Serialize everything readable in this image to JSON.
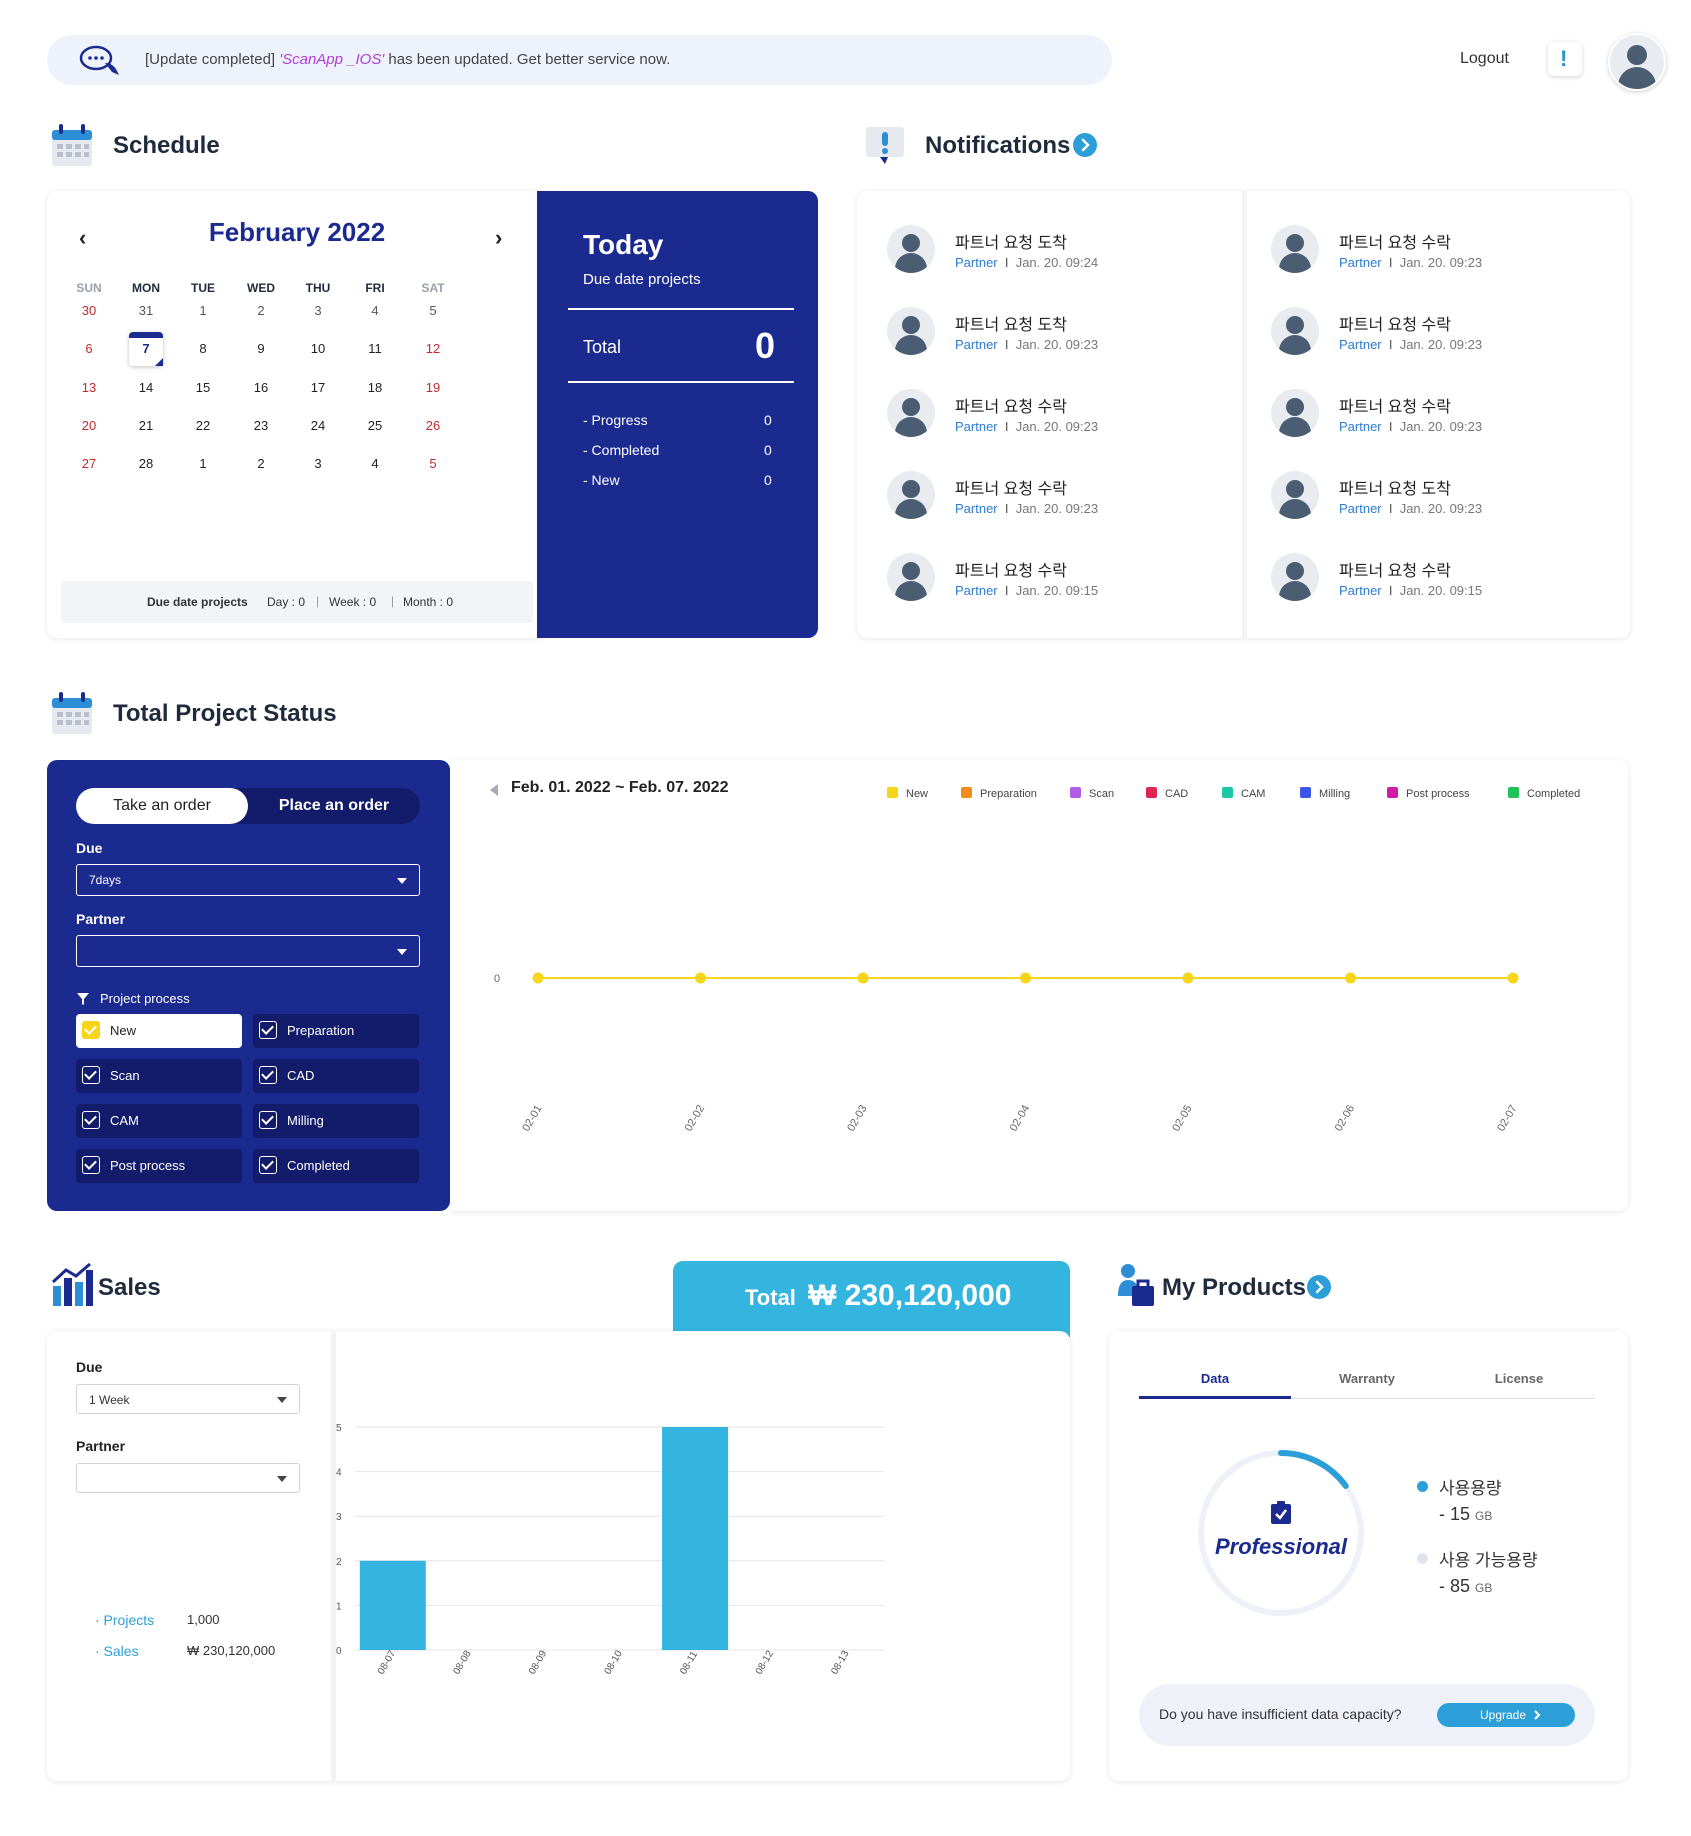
{
  "banner": {
    "prefix": "[Update completed]",
    "app": "'ScanApp _IOS'",
    "suffix": "has been updated. Get better service now."
  },
  "header": {
    "logout_label": "Logout",
    "alert_glyph": "!"
  },
  "schedule": {
    "title": "Schedule",
    "month_label": "February 2022",
    "weekdays": [
      "SUN",
      "MON",
      "TUE",
      "WED",
      "THU",
      "FRI",
      "SAT"
    ],
    "weeks": [
      [
        "30",
        "31",
        "1",
        "2",
        "3",
        "4",
        "5"
      ],
      [
        "6",
        "7",
        "8",
        "9",
        "10",
        "11",
        "12"
      ],
      [
        "13",
        "14",
        "15",
        "16",
        "17",
        "18",
        "19"
      ],
      [
        "20",
        "21",
        "22",
        "23",
        "24",
        "25",
        "26"
      ],
      [
        "27",
        "28",
        "1",
        "2",
        "3",
        "4",
        "5"
      ]
    ],
    "today_date": "7",
    "footer": {
      "label": "Due date projects",
      "day": "Day : 0",
      "week": "Week : 0",
      "month": "Month : 0"
    }
  },
  "today": {
    "title": "Today",
    "subtitle": "Due date projects",
    "total_label": "Total",
    "total_value": "0",
    "rows": [
      {
        "label": "- Progress",
        "value": "0"
      },
      {
        "label": "- Completed",
        "value": "0"
      },
      {
        "label": "- New",
        "value": "0"
      }
    ]
  },
  "notifications": {
    "title": "Notifications",
    "left": [
      {
        "title": "파트너 요청 도착",
        "partner": "Partner",
        "time": "Jan. 20. 09:24"
      },
      {
        "title": "파트너 요청 도착",
        "partner": "Partner",
        "time": "Jan. 20. 09:23"
      },
      {
        "title": "파트너 요청 수락",
        "partner": "Partner",
        "time": "Jan. 20. 09:23"
      },
      {
        "title": "파트너 요청 수락",
        "partner": "Partner",
        "time": "Jan. 20. 09:23"
      },
      {
        "title": "파트너 요청 수락",
        "partner": "Partner",
        "time": "Jan. 20. 09:15"
      }
    ],
    "right": [
      {
        "title": "파트너 요청 수락",
        "partner": "Partner",
        "time": "Jan. 20. 09:23"
      },
      {
        "title": "파트너 요청 수락",
        "partner": "Partner",
        "time": "Jan. 20. 09:23"
      },
      {
        "title": "파트너 요청 수락",
        "partner": "Partner",
        "time": "Jan. 20. 09:23"
      },
      {
        "title": "파트너 요청 도착",
        "partner": "Partner",
        "time": "Jan. 20. 09:23"
      },
      {
        "title": "파트너 요청 수락",
        "partner": "Partner",
        "time": "Jan. 20. 09:15"
      }
    ]
  },
  "project_status": {
    "title": "Total Project Status",
    "tabs": [
      "Take an order",
      "Place an order"
    ],
    "due_label": "Due",
    "due_value": "7days",
    "partner_label": "Partner",
    "partner_value": "",
    "process_label": "Project process",
    "checks": [
      {
        "label": "New",
        "checked": true
      },
      {
        "label": "Preparation",
        "checked": true
      },
      {
        "label": "Scan",
        "checked": true
      },
      {
        "label": "CAD",
        "checked": true
      },
      {
        "label": "CAM",
        "checked": true
      },
      {
        "label": "Milling",
        "checked": true
      },
      {
        "label": "Post process",
        "checked": true
      },
      {
        "label": "Completed",
        "checked": true
      }
    ],
    "date_range": "Feb. 01. 2022 ~ Feb. 07. 2022"
  },
  "status_chart": {
    "chart_data": {
      "type": "line",
      "x": [
        "02-01",
        "02-02",
        "02-03",
        "02-04",
        "02-05",
        "02-06",
        "02-07"
      ],
      "series": [
        {
          "name": "New",
          "color": "#f7d51a",
          "values": [
            0,
            0,
            0,
            0,
            0,
            0,
            0
          ]
        }
      ],
      "legend": [
        {
          "name": "New",
          "color": "#f7d51a"
        },
        {
          "name": "Preparation",
          "color": "#f28c1a"
        },
        {
          "name": "Scan",
          "color": "#b25de8"
        },
        {
          "name": "CAD",
          "color": "#e02455"
        },
        {
          "name": "CAM",
          "color": "#1cc7a8"
        },
        {
          "name": "Milling",
          "color": "#3c55e8"
        },
        {
          "name": "Post process",
          "color": "#d11aa9"
        },
        {
          "name": "Completed",
          "color": "#22c25a"
        }
      ],
      "y_ticks": [
        "0"
      ],
      "legend_position": "top-right"
    }
  },
  "sales": {
    "title": "Sales",
    "total_label": "Total",
    "total_value": "₩ 230,120,000",
    "due_label": "Due",
    "due_value": "1 Week",
    "partner_label": "Partner",
    "partner_value": "",
    "summary": [
      {
        "label": "· Projects",
        "value": "1,000"
      },
      {
        "label": "· Sales",
        "value": "₩ 230,120,000"
      }
    ]
  },
  "sales_chart": {
    "chart_data": {
      "type": "bar",
      "categories": [
        "08-07",
        "08-08",
        "08-09",
        "08-10",
        "08-11",
        "08-12",
        "08-13"
      ],
      "values": [
        2,
        0,
        0,
        0,
        5,
        0,
        0
      ],
      "ylim": [
        0,
        5
      ],
      "y_ticks": [
        "0",
        "1",
        "2",
        "3",
        "4",
        "5"
      ],
      "color": "#33b5e0",
      "grid": true
    }
  },
  "products": {
    "title": "My Products",
    "tabs": [
      "Data",
      "Warranty",
      "License"
    ],
    "active_tab": "Data",
    "plan": "Professional",
    "used_label": "사용용량",
    "used_value": "- 15",
    "used_unit": "GB",
    "free_label": "사용 가능용량",
    "free_value": "- 85",
    "free_unit": "GB",
    "used_fraction": 0.15,
    "upgrade_prompt": "Do you have insufficient data capacity?",
    "upgrade_label": "Upgrade"
  }
}
